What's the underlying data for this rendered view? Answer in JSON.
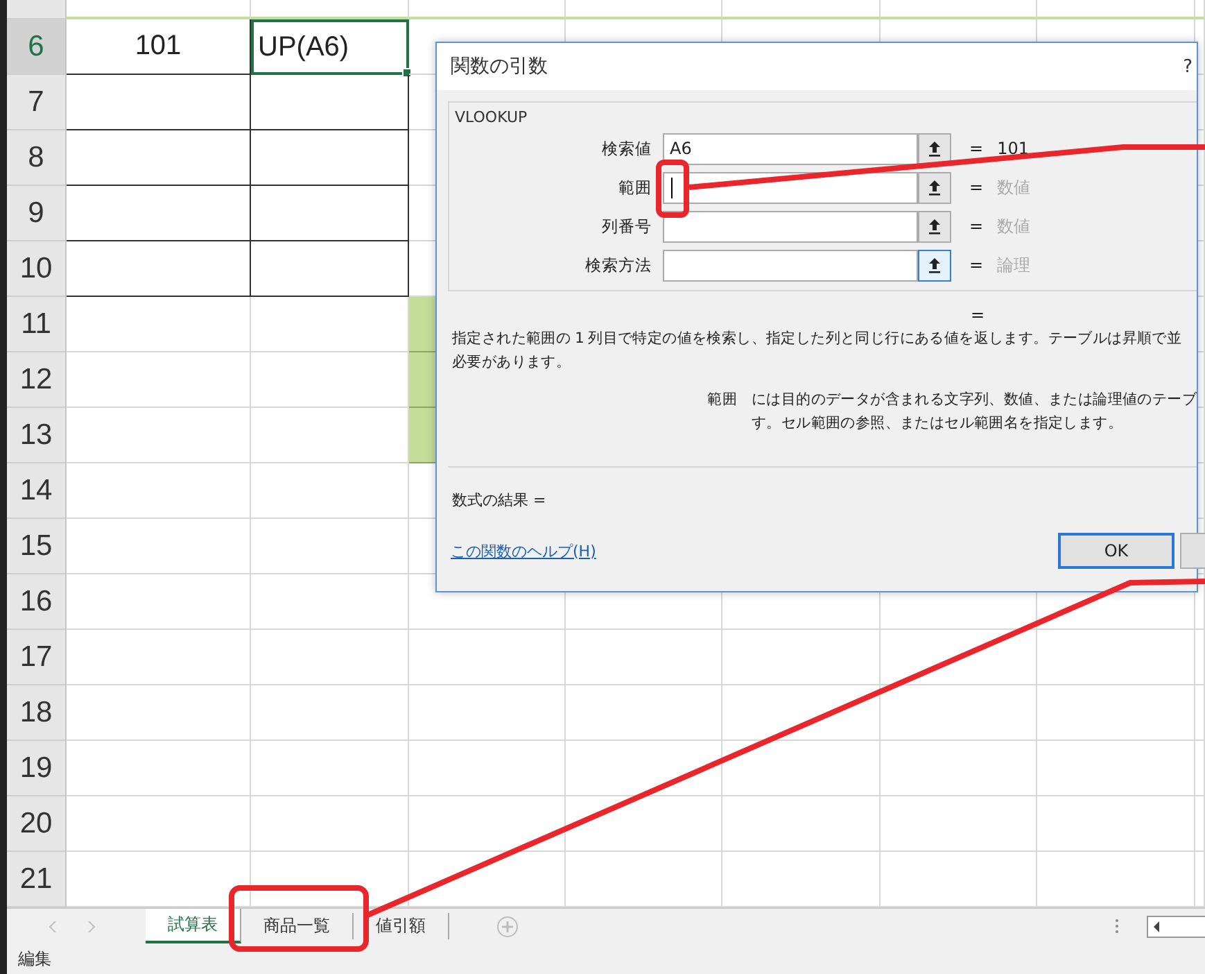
{
  "sheet": {
    "rows": [
      {
        "number": "6",
        "selected": true,
        "bordered": true,
        "highlighted": false,
        "cells": [
          {
            "text": "101",
            "selected": false
          },
          {
            "text": "UP(A6)",
            "selected": true
          }
        ]
      },
      {
        "number": "7",
        "selected": false,
        "bordered": true,
        "highlighted": false
      },
      {
        "number": "8",
        "selected": false,
        "bordered": true,
        "highlighted": false
      },
      {
        "number": "9",
        "selected": false,
        "bordered": true,
        "highlighted": false
      },
      {
        "number": "10",
        "selected": false,
        "bordered": true,
        "highlighted": false
      },
      {
        "number": "11",
        "selected": false,
        "bordered": false,
        "highlighted": true
      },
      {
        "number": "12",
        "selected": false,
        "bordered": false,
        "highlighted": true
      },
      {
        "number": "13",
        "selected": false,
        "bordered": false,
        "highlighted": true
      },
      {
        "number": "14",
        "selected": false,
        "bordered": false,
        "highlighted": false
      },
      {
        "number": "15",
        "selected": false,
        "bordered": false,
        "highlighted": false
      },
      {
        "number": "16",
        "selected": false,
        "bordered": false,
        "highlighted": false
      },
      {
        "number": "17",
        "selected": false,
        "bordered": false,
        "highlighted": false
      },
      {
        "number": "18",
        "selected": false,
        "bordered": false,
        "highlighted": false
      },
      {
        "number": "19",
        "selected": false,
        "bordered": false,
        "highlighted": false
      },
      {
        "number": "20",
        "selected": false,
        "bordered": false,
        "highlighted": false
      },
      {
        "number": "21",
        "selected": false,
        "bordered": false,
        "highlighted": false
      }
    ]
  },
  "sheet_tabs": [
    {
      "label": "試算表",
      "selected": true
    },
    {
      "label": "商品一覧",
      "selected": false
    },
    {
      "label": "値引額",
      "selected": false
    }
  ],
  "status_bar": {
    "mode": "編集"
  },
  "dialog": {
    "title": "関数の引数",
    "help_mark": "?",
    "function_name": "VLOOKUP",
    "arguments": [
      {
        "label": "検索値",
        "value": "A6",
        "cursor": false,
        "equals": "=",
        "result": "101",
        "evaluated": true,
        "focused": false
      },
      {
        "label": "範囲",
        "cursor": true,
        "equals": "=",
        "result": "数値",
        "evaluated": false,
        "focused": false
      },
      {
        "label": "列番号",
        "cursor": false,
        "equals": "=",
        "result": "数値",
        "evaluated": false,
        "focused": false
      },
      {
        "label": "検索方法",
        "cursor": false,
        "equals": "=",
        "result": "論理",
        "evaluated": false,
        "focused": true
      }
    ],
    "overall_result": "=",
    "description": [
      "指定された範囲の 1 列目で特定の値を検索し、指定した列と同じ行にある値を返します。テーブルは昇順で並",
      "必要があります。"
    ],
    "argument_help": {
      "label": "範囲",
      "lines": [
        "には目的のデータが含まれる文字列、数値、または論理値のテーブ",
        "す。セル範囲の参照、またはセル範囲名を指定します。"
      ]
    },
    "formula_result": "数式の結果 =",
    "help_link": "この関数のヘルプ(H)",
    "buttons": [
      "OK"
    ]
  }
}
